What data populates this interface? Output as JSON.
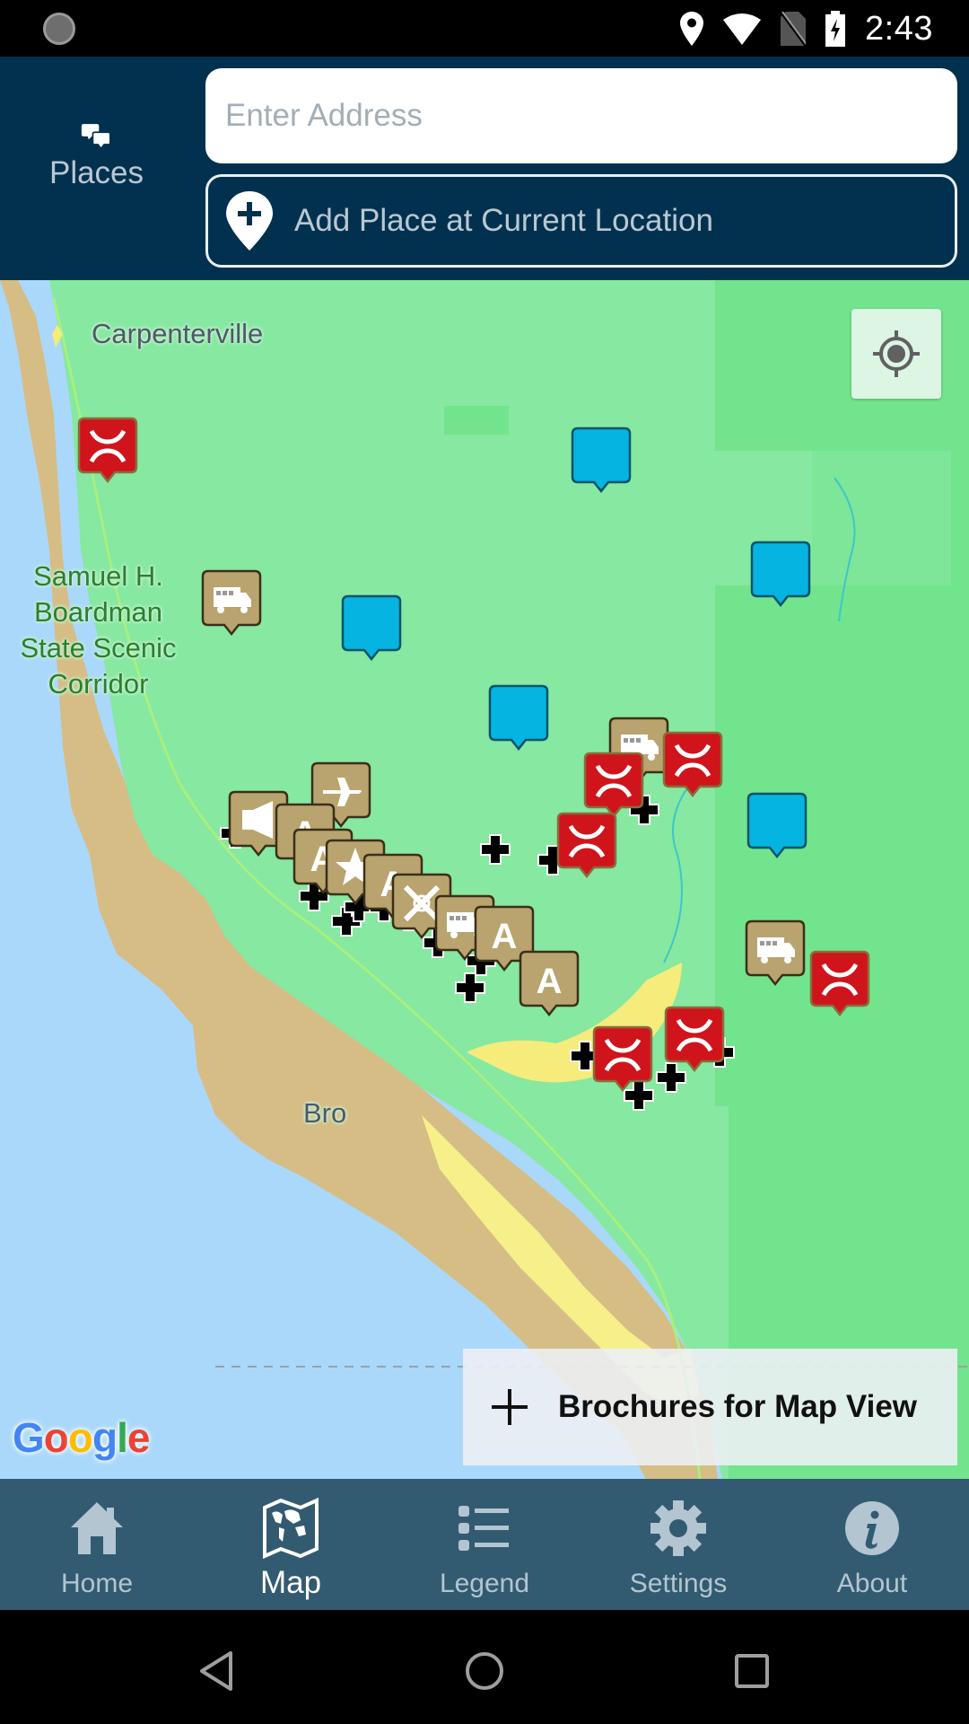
{
  "status_bar": {
    "time": "2:43",
    "icons": [
      "sync-icon",
      "location-icon",
      "wifi-icon",
      "no-sim-icon",
      "battery-charging-icon"
    ]
  },
  "header": {
    "places_label": "Places",
    "address_placeholder": "Enter Address",
    "address_value": "",
    "add_place_label": "Add Place at Current Location"
  },
  "map": {
    "labels": {
      "town_north": "Carpenterville",
      "park": "Samuel H. Boardman State Scenic Corridor",
      "town_south": "Bro"
    },
    "locate_button": "my-location-icon",
    "attribution": "Google",
    "brochures_button": "Brochures for Map View",
    "colors": {
      "ocean": "#aad8fb",
      "land_sand": "#d6bd85",
      "forest": "#86e8a1",
      "forest_dark": "#72e48d",
      "marker_brown": "#b9a46f",
      "marker_red": "#d0141b",
      "marker_blue": "#05b4e0"
    },
    "markers": [
      {
        "type": "red-bridge"
      },
      {
        "type": "blue-place"
      },
      {
        "type": "blue-place"
      },
      {
        "type": "brown-rv"
      },
      {
        "type": "blue-place"
      },
      {
        "type": "blue-place"
      },
      {
        "type": "brown-rv"
      },
      {
        "type": "red-bridge"
      },
      {
        "type": "red-bridge"
      },
      {
        "type": "red-bridge"
      },
      {
        "type": "blue-place"
      },
      {
        "type": "brown-airport"
      },
      {
        "type": "brown-megaphone"
      },
      {
        "type": "brown-a"
      },
      {
        "type": "brown-a"
      },
      {
        "type": "brown-star"
      },
      {
        "type": "brown-a"
      },
      {
        "type": "brown-crossed-tools"
      },
      {
        "type": "brown-rv"
      },
      {
        "type": "brown-a"
      },
      {
        "type": "brown-a"
      },
      {
        "type": "brown-rv"
      },
      {
        "type": "red-bridge"
      },
      {
        "type": "red-bridge"
      },
      {
        "type": "red-bridge"
      }
    ]
  },
  "bottom_nav": {
    "items": [
      {
        "label": "Home",
        "icon": "home-icon",
        "active": false
      },
      {
        "label": "Map",
        "icon": "world-map-icon",
        "active": true
      },
      {
        "label": "Legend",
        "icon": "list-icon",
        "active": false
      },
      {
        "label": "Settings",
        "icon": "gear-icon",
        "active": false
      },
      {
        "label": "About",
        "icon": "info-icon",
        "active": false
      }
    ]
  },
  "system_nav": {
    "back": "back-icon",
    "home": "home-circle-icon",
    "recents": "recents-icon"
  }
}
